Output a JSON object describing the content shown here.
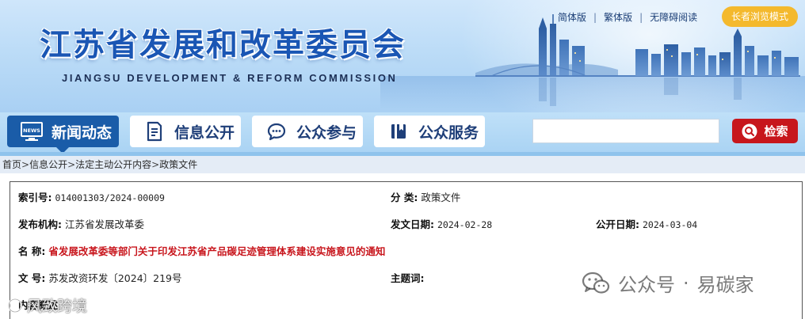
{
  "header": {
    "title": "江苏省发展和改革委员会",
    "subtitle": "JIANGSU DEVELOPMENT & REFORM COMMISSION",
    "top_links": [
      "简体版",
      "繁体版",
      "无障碍阅读"
    ],
    "separator": "|",
    "elder_mode": "长者浏览模式"
  },
  "nav": {
    "items": [
      {
        "label": "新闻动态",
        "icon": "news-icon",
        "active": true
      },
      {
        "label": "信息公开",
        "icon": "document-icon",
        "active": false
      },
      {
        "label": "公众参与",
        "icon": "chat-bubble-icon",
        "active": false
      },
      {
        "label": "公众服务",
        "icon": "book-icon",
        "active": false
      }
    ],
    "search_placeholder": "",
    "search_button": "检索",
    "news_badge": "NEWS"
  },
  "breadcrumb": {
    "items": [
      "首页",
      "信息公开",
      "法定主动公开内容",
      "政策文件"
    ],
    "separator": ">"
  },
  "info": {
    "index_label": "索引号:",
    "index_value": "014001303/2024-00009",
    "category_label": "分 类:",
    "category_value": "政策文件",
    "publisher_label": "发布机构:",
    "publisher_value": "江苏省发展改革委",
    "issue_date_label": "发文日期:",
    "issue_date_value": "2024-02-28",
    "publish_date_label": "公开日期:",
    "publish_date_value": "2024-03-04",
    "name_label": "名 称:",
    "name_value": "省发展改革委等部门关于印发江苏省产品碳足迹管理体系建设实施意见的通知",
    "docno_label": "文 号:",
    "docno_value": "苏发改资环发〔2024〕219号",
    "subject_label": "主题词:",
    "subject_value": "",
    "summary_label": "内容概述"
  },
  "watermark": {
    "right_prefix": "公众号",
    "right_dot": "·",
    "right_name": "易碳家",
    "left_text": "风致跨境"
  },
  "colors": {
    "brand_blue": "#1a56b4",
    "nav_active": "#1a5ca8",
    "search_red": "#c7161c",
    "elder_yellow": "#f4b92d",
    "title_red": "#c8161d"
  }
}
